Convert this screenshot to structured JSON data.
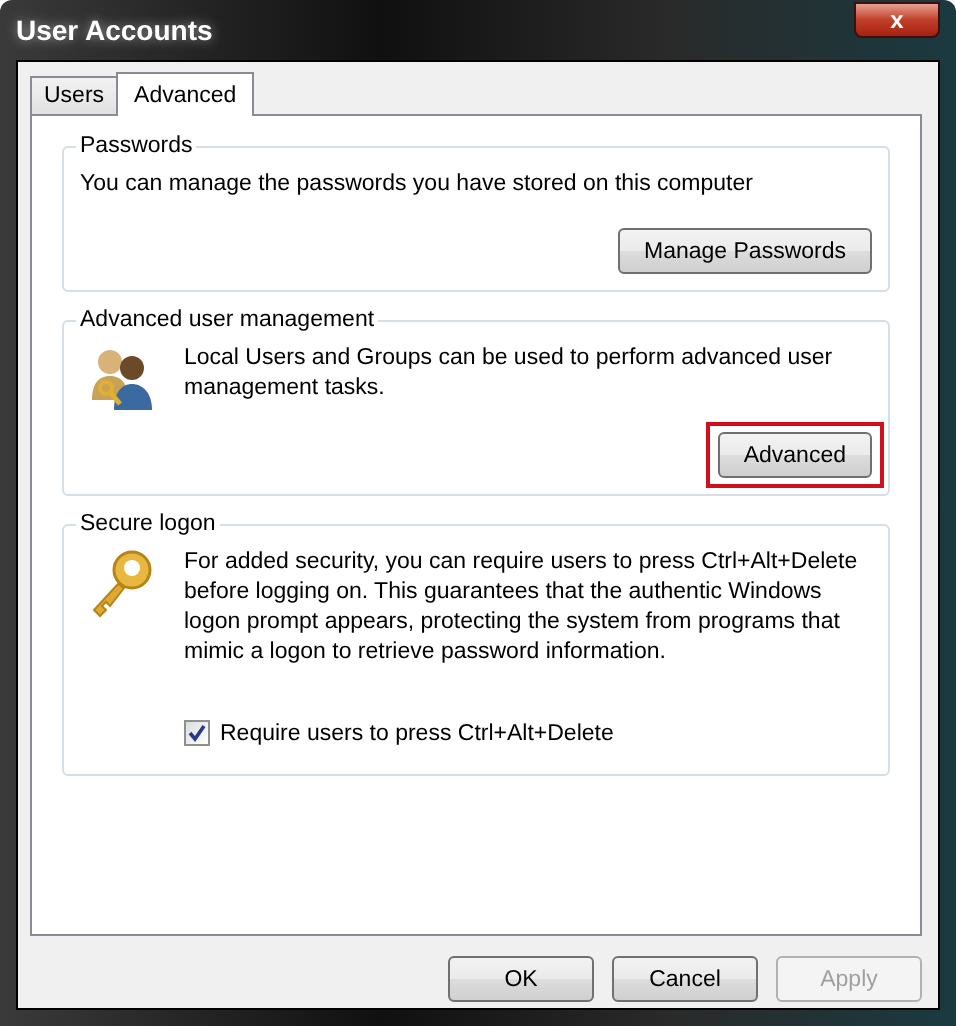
{
  "window": {
    "title": "User Accounts",
    "close_label": "x"
  },
  "tabs": [
    {
      "label": "Users",
      "selected": false
    },
    {
      "label": "Advanced",
      "selected": true
    }
  ],
  "groups": [
    {
      "kind": "button",
      "title": "Passwords",
      "text": "You can manage the passwords you have stored on this computer",
      "button": {
        "label": "Manage Passwords",
        "highlighted": false
      }
    },
    {
      "kind": "users",
      "title": "Advanced user management",
      "text": "Local Users and Groups can be used to perform advanced user management tasks.",
      "button": {
        "label": "Advanced",
        "highlighted": true
      }
    },
    {
      "kind": "key",
      "title": "Secure logon",
      "text": "For added security, you can require users to press Ctrl+Alt+Delete before logging on. This guarantees that the authentic Windows logon prompt appears, protecting the system from programs that mimic a logon to retrieve password information.",
      "checkbox": {
        "label": "Require users to press Ctrl+Alt+Delete",
        "checked": true
      }
    }
  ],
  "buttons": [
    {
      "label": "OK",
      "disabled": false
    },
    {
      "label": "Cancel",
      "disabled": false
    },
    {
      "label": "Apply",
      "disabled": true
    }
  ]
}
